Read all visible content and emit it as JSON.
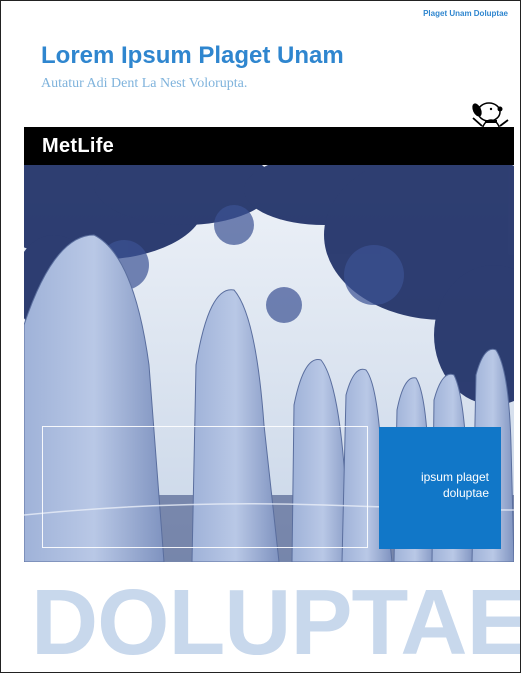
{
  "header": {
    "tag": "Plaget Unam Doluptae",
    "title": "Lorem Ipsum Plaget Unam",
    "subtitle": "Autatur Adi Dent La Nest Volorupta."
  },
  "brand": {
    "name": "MetLife",
    "mascot": "snoopy-mascot-icon"
  },
  "hero": {
    "caption": "ipsum plaget\ndoluptae"
  },
  "footer": {
    "big_word": "DOLUPTAE"
  },
  "colors": {
    "accent": "#2f86cf",
    "accent_light": "#7fb3dc",
    "cta_bg": "#1177c8",
    "big_word": "#c8d8ec",
    "brand_bar": "#000000"
  }
}
